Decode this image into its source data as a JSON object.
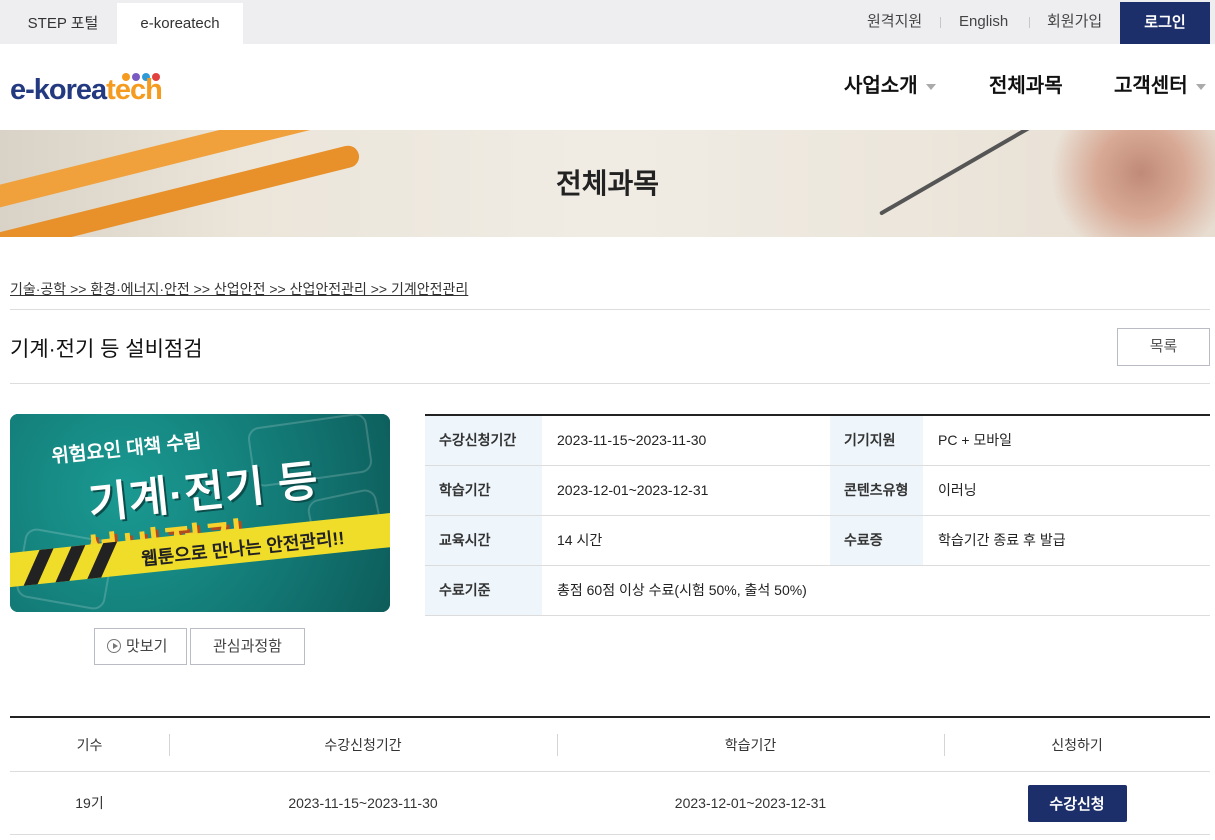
{
  "topbar": {
    "tabs": [
      "STEP 포털",
      "e-koreatech"
    ],
    "links": [
      "원격지원",
      "English",
      "회원가입"
    ],
    "login_label": "로그인"
  },
  "header": {
    "logo": {
      "part1": "e-korea",
      "part2": "tech",
      "dot_colors": [
        "#f59b1f",
        "#7a5bc2",
        "#2f9bd6",
        "#e2413f"
      ]
    },
    "nav": [
      "사업소개",
      "전체과목",
      "고객센터"
    ]
  },
  "banner": {
    "title": "전체과목"
  },
  "breadcrumb": "기술·공학 >> 환경·에너지·안전 >> 산업안전 >> 산업안전관리 >> 기계안전관리",
  "course": {
    "title": "기계·전기 등 설비점검",
    "list_button": "목록",
    "thumbnail": {
      "subtitle": "위험요인 대책 수립",
      "line1": "기계·전기 등",
      "line2": "설비점검",
      "tape": "웹툰으로 만나는 안전관리!!"
    },
    "preview_button": "맛보기",
    "wish_button": "관심과정함",
    "info": [
      {
        "label": "수강신청기간",
        "value": "2023-11-15~2023-11-30",
        "label2": "기기지원",
        "value2": "PC + 모바일"
      },
      {
        "label": "학습기간",
        "value": "2023-12-01~2023-12-31",
        "label2": "콘텐츠유형",
        "value2": "이러닝"
      },
      {
        "label": "교육시간",
        "value": "14 시간",
        "label2": "수료증",
        "value2": "학습기간 종료 후 발급"
      },
      {
        "label": "수료기준",
        "value": "총점 60점 이상 수료(시험 50%, 출석 50%)"
      }
    ]
  },
  "schedule": {
    "headers": [
      "기수",
      "수강신청기간",
      "학습기간",
      "신청하기"
    ],
    "rows": [
      {
        "term": "19기",
        "apply_period": "2023-11-15~2023-11-30",
        "study_period": "2023-12-01~2023-12-31",
        "button": "수강신청"
      }
    ]
  }
}
